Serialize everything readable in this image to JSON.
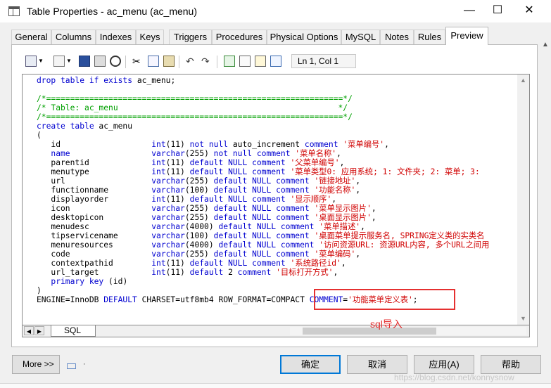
{
  "window": {
    "title": "Table Properties - ac_menu (ac_menu)",
    "minimize": "—",
    "maximize": "☐",
    "close": "✕"
  },
  "tabs": [
    {
      "label": "General"
    },
    {
      "label": "Columns"
    },
    {
      "label": "Indexes"
    },
    {
      "label": "Keys"
    },
    {
      "label": "Triggers"
    },
    {
      "label": "Procedures"
    },
    {
      "label": "Physical Options"
    },
    {
      "label": "MySQL"
    },
    {
      "label": "Notes"
    },
    {
      "label": "Rules"
    },
    {
      "label": "Preview"
    }
  ],
  "active_tab": "Preview",
  "toolbar": {
    "position": "Ln 1, Col 1",
    "icons": [
      "properties-icon",
      "edit-icon",
      "save-icon",
      "print-icon",
      "find-icon",
      "cut-icon",
      "copy-icon",
      "paste-icon",
      "undo-icon",
      "redo-icon",
      "refresh-icon",
      "insert-icon",
      "edit-with-icon",
      "checkbox-icon"
    ]
  },
  "editor": {
    "tab_label": "SQL",
    "lines": [
      [
        {
          "t": "drop table if exists",
          "c": "kw"
        },
        {
          "t": " ac_menu;",
          "c": "pl"
        }
      ],
      [],
      [
        {
          "t": "/*==============================================================*/",
          "c": "cm"
        }
      ],
      [
        {
          "t": "/* Table: ac_menu                                              */",
          "c": "cm"
        }
      ],
      [
        {
          "t": "/*==============================================================*/",
          "c": "cm"
        }
      ],
      [
        {
          "t": "create table",
          "c": "kw"
        },
        {
          "t": " ac_menu",
          "c": "pl"
        }
      ],
      [
        {
          "t": "(",
          "c": "pl"
        }
      ],
      [
        {
          "t": "   id                   ",
          "c": "pl"
        },
        {
          "t": "int",
          "c": "kw"
        },
        {
          "t": "(11) ",
          "c": "pl"
        },
        {
          "t": "not null",
          "c": "kw"
        },
        {
          "t": " auto_increment ",
          "c": "pl"
        },
        {
          "t": "comment",
          "c": "kw"
        },
        {
          "t": " '菜单编号'",
          "c": "st"
        },
        {
          "t": ",",
          "c": "pl"
        }
      ],
      [
        {
          "t": "   ",
          "c": "pl"
        },
        {
          "t": "name",
          "c": "kw"
        },
        {
          "t": "                 ",
          "c": "pl"
        },
        {
          "t": "varchar",
          "c": "kw"
        },
        {
          "t": "(255) ",
          "c": "pl"
        },
        {
          "t": "not null comment",
          "c": "kw"
        },
        {
          "t": " '菜单名称'",
          "c": "st"
        },
        {
          "t": ",",
          "c": "pl"
        }
      ],
      [
        {
          "t": "   parentid             ",
          "c": "pl"
        },
        {
          "t": "int",
          "c": "kw"
        },
        {
          "t": "(11) ",
          "c": "pl"
        },
        {
          "t": "default NULL comment",
          "c": "kw"
        },
        {
          "t": " '父菜单编号'",
          "c": "st"
        },
        {
          "t": ",",
          "c": "pl"
        }
      ],
      [
        {
          "t": "   menutype             ",
          "c": "pl"
        },
        {
          "t": "int",
          "c": "kw"
        },
        {
          "t": "(11) ",
          "c": "pl"
        },
        {
          "t": "default NULL comment",
          "c": "kw"
        },
        {
          "t": " '菜单类型0: 应用系统; 1: 文件夹; 2: 菜单; 3:",
          "c": "st"
        }
      ],
      [
        {
          "t": "   url                  ",
          "c": "pl"
        },
        {
          "t": "varchar",
          "c": "kw"
        },
        {
          "t": "(255) ",
          "c": "pl"
        },
        {
          "t": "default NULL comment",
          "c": "kw"
        },
        {
          "t": " '链接地址'",
          "c": "st"
        },
        {
          "t": ",",
          "c": "pl"
        }
      ],
      [
        {
          "t": "   functionname         ",
          "c": "pl"
        },
        {
          "t": "varchar",
          "c": "kw"
        },
        {
          "t": "(100) ",
          "c": "pl"
        },
        {
          "t": "default NULL comment",
          "c": "kw"
        },
        {
          "t": " '功能名称'",
          "c": "st"
        },
        {
          "t": ",",
          "c": "pl"
        }
      ],
      [
        {
          "t": "   displayorder         ",
          "c": "pl"
        },
        {
          "t": "int",
          "c": "kw"
        },
        {
          "t": "(11) ",
          "c": "pl"
        },
        {
          "t": "default NULL comment",
          "c": "kw"
        },
        {
          "t": " '显示顺序'",
          "c": "st"
        },
        {
          "t": ",",
          "c": "pl"
        }
      ],
      [
        {
          "t": "   icon                 ",
          "c": "pl"
        },
        {
          "t": "varchar",
          "c": "kw"
        },
        {
          "t": "(255) ",
          "c": "pl"
        },
        {
          "t": "default NULL comment",
          "c": "kw"
        },
        {
          "t": " '菜单显示图片'",
          "c": "st"
        },
        {
          "t": ",",
          "c": "pl"
        }
      ],
      [
        {
          "t": "   desktopicon          ",
          "c": "pl"
        },
        {
          "t": "varchar",
          "c": "kw"
        },
        {
          "t": "(255) ",
          "c": "pl"
        },
        {
          "t": "default NULL comment",
          "c": "kw"
        },
        {
          "t": " '桌面显示图片'",
          "c": "st"
        },
        {
          "t": ",",
          "c": "pl"
        }
      ],
      [
        {
          "t": "   menudesc             ",
          "c": "pl"
        },
        {
          "t": "varchar",
          "c": "kw"
        },
        {
          "t": "(4000) ",
          "c": "pl"
        },
        {
          "t": "default NULL comment",
          "c": "kw"
        },
        {
          "t": " '菜单描述'",
          "c": "st"
        },
        {
          "t": ",",
          "c": "pl"
        }
      ],
      [
        {
          "t": "   tipservicename       ",
          "c": "pl"
        },
        {
          "t": "varchar",
          "c": "kw"
        },
        {
          "t": "(100) ",
          "c": "pl"
        },
        {
          "t": "default NULL comment",
          "c": "kw"
        },
        {
          "t": " '桌面菜单提示服务名, SPRING定义类的实类名",
          "c": "st"
        }
      ],
      [
        {
          "t": "   menuresources        ",
          "c": "pl"
        },
        {
          "t": "varchar",
          "c": "kw"
        },
        {
          "t": "(4000) ",
          "c": "pl"
        },
        {
          "t": "default NULL comment",
          "c": "kw"
        },
        {
          "t": " '访问资源URL: 资源URL内容, 多个URL之间用",
          "c": "st"
        }
      ],
      [
        {
          "t": "   code                 ",
          "c": "pl"
        },
        {
          "t": "varchar",
          "c": "kw"
        },
        {
          "t": "(255) ",
          "c": "pl"
        },
        {
          "t": "default NULL comment",
          "c": "kw"
        },
        {
          "t": " '菜单编码'",
          "c": "st"
        },
        {
          "t": ",",
          "c": "pl"
        }
      ],
      [
        {
          "t": "   contextpathid        ",
          "c": "pl"
        },
        {
          "t": "int",
          "c": "kw"
        },
        {
          "t": "(11) ",
          "c": "pl"
        },
        {
          "t": "default NULL comment",
          "c": "kw"
        },
        {
          "t": " '系统路径id'",
          "c": "st"
        },
        {
          "t": ",",
          "c": "pl"
        }
      ],
      [
        {
          "t": "   url_target           ",
          "c": "pl"
        },
        {
          "t": "int",
          "c": "kw"
        },
        {
          "t": "(11) ",
          "c": "pl"
        },
        {
          "t": "default",
          "c": "kw"
        },
        {
          "t": " 2 ",
          "c": "pl"
        },
        {
          "t": "comment",
          "c": "kw"
        },
        {
          "t": " '目标打开方式'",
          "c": "st"
        },
        {
          "t": ",",
          "c": "pl"
        }
      ],
      [
        {
          "t": "   ",
          "c": "pl"
        },
        {
          "t": "primary key",
          "c": "kw"
        },
        {
          "t": " (id)",
          "c": "pl"
        }
      ],
      [
        {
          "t": ")",
          "c": "pl"
        }
      ],
      [
        {
          "t": "ENGINE=InnoDB ",
          "c": "pl"
        },
        {
          "t": "DEFAULT",
          "c": "kw"
        },
        {
          "t": " CHARSET=utf8mb4 ROW_FORMAT=COMPACT ",
          "c": "pl"
        },
        {
          "t": "COMMENT",
          "c": "kw"
        },
        {
          "t": "=",
          "c": "pl"
        },
        {
          "t": "'功能菜单定义表'",
          "c": "st"
        },
        {
          "t": ";",
          "c": "pl"
        }
      ]
    ]
  },
  "annotation": {
    "label": "sql导入",
    "color": "#e53030"
  },
  "footer": {
    "more": "More >>",
    "ok": "确定",
    "cancel": "取消",
    "apply": "应用(A)",
    "help": "帮助",
    "dot": "·"
  },
  "watermark": "https://blog.csdn.net/konnysnow",
  "colors": {
    "keyword": "#0000d0",
    "comment": "#00a000",
    "string": "#d00000",
    "focus": "#0078d7"
  }
}
